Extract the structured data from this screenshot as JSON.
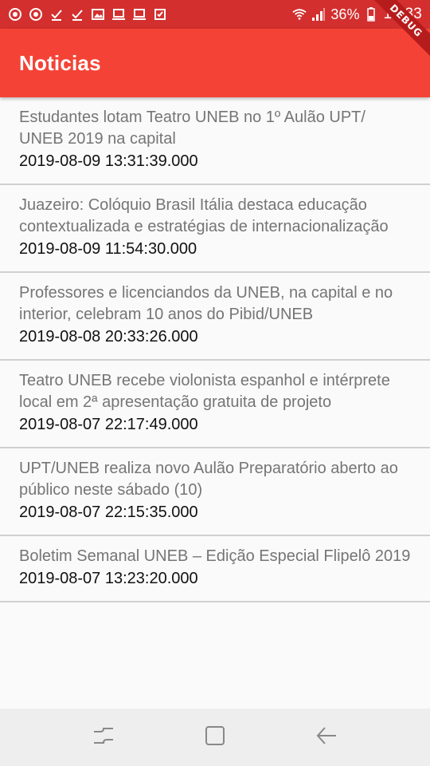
{
  "status_bar": {
    "battery": "36%",
    "time": "16:33"
  },
  "app_bar": {
    "title": "Noticias",
    "debug_banner": "DEBUG"
  },
  "news": [
    {
      "title": "Estudantes lotam Teatro UNEB no 1º Aulão UPT/ UNEB 2019 na capital",
      "date": "2019-08-09 13:31:39.000"
    },
    {
      "title": "Juazeiro: Colóquio Brasil Itália destaca educação contextualizada e estratégias de internacionalização",
      "date": "2019-08-09 11:54:30.000"
    },
    {
      "title": "Professores e licenciandos da UNEB, na capital e no interior, celebram 10 anos do Pibid/UNEB",
      "date": "2019-08-08 20:33:26.000"
    },
    {
      "title": "Teatro UNEB recebe violonista espanhol e intérprete local em 2ª apresentação gratuita de projeto",
      "date": "2019-08-07 22:17:49.000"
    },
    {
      "title": "UPT/UNEB realiza novo Aulão Preparatório aberto ao público neste sábado (10)",
      "date": "2019-08-07 22:15:35.000"
    },
    {
      "title": "Boletim Semanal UNEB – Edição Especial Flipelô 2019",
      "date": "2019-08-07 13:23:20.000"
    }
  ],
  "colors": {
    "status_bar": "#d32f2f",
    "app_bar": "#f44336",
    "title_text": "#757575",
    "date_text": "#111111"
  },
  "icons": [
    "chrome-icon",
    "chrome-icon",
    "check-icon",
    "check-icon",
    "image-icon",
    "laptop-icon",
    "laptop-icon",
    "task-icon",
    "wifi-icon",
    "signal-icon",
    "battery-icon",
    "recents-icon",
    "home-icon",
    "back-icon"
  ]
}
